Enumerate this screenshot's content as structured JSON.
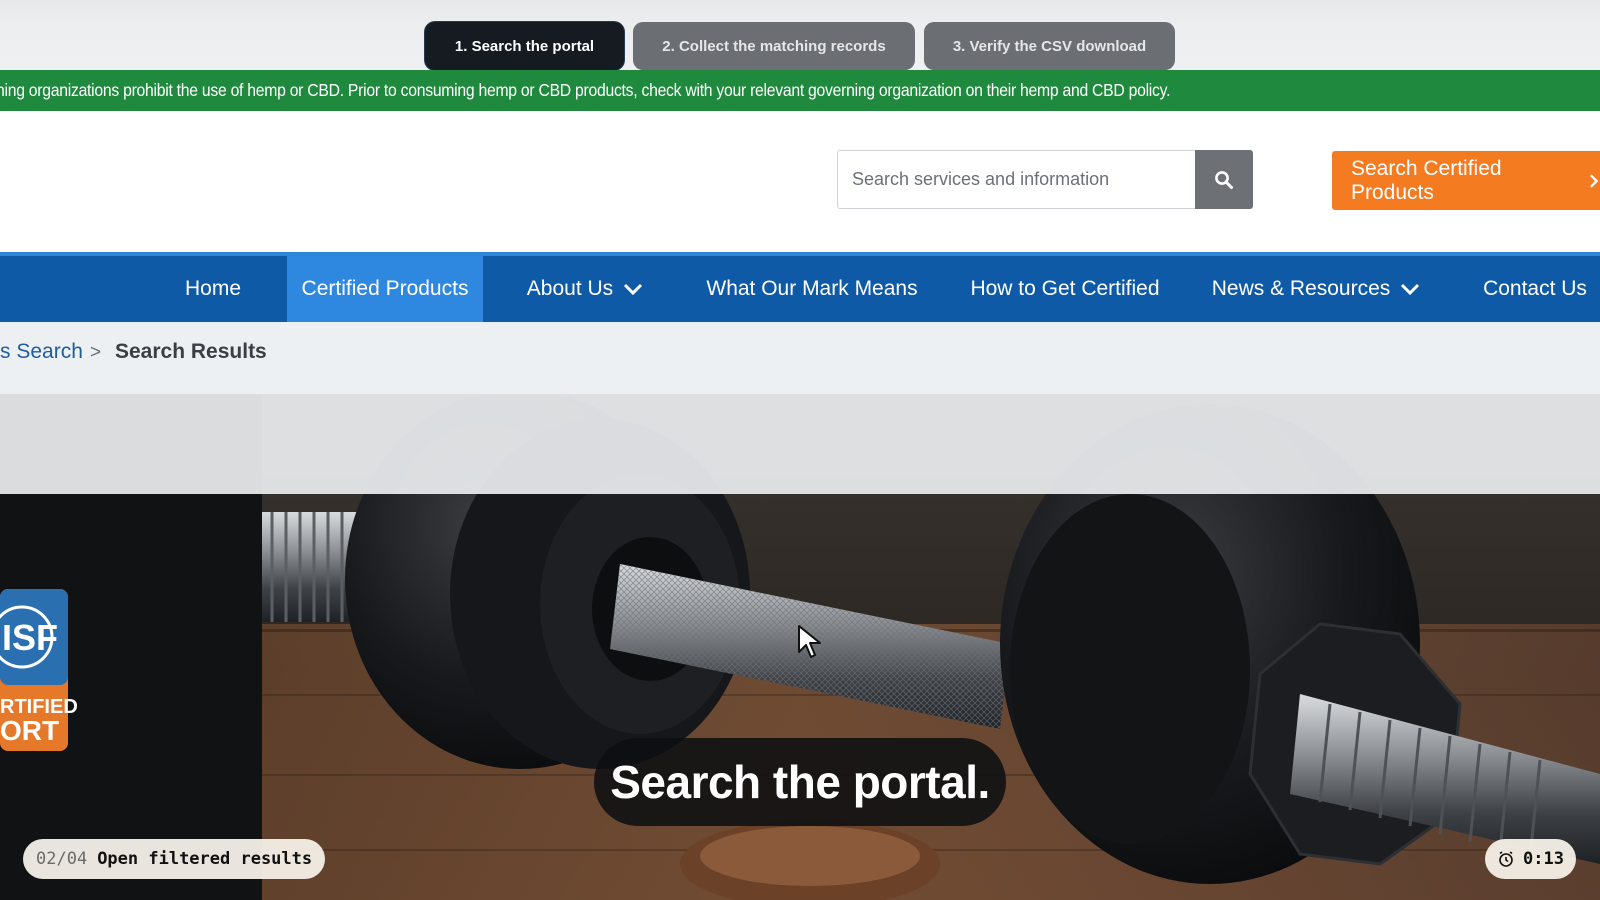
{
  "steps": [
    {
      "label": "1. Search the portal",
      "state": "active"
    },
    {
      "label": "2. Collect the matching records",
      "state": "inactive"
    },
    {
      "label": "3. Verify the CSV download",
      "state": "inactive"
    }
  ],
  "notice": {
    "text": "ning organizations prohibit the use of hemp or CBD. Prior to consuming hemp or CBD products, check with your relevant governing organization on their hemp and CBD policy.",
    "color": "#1f8a3d"
  },
  "header": {
    "search_placeholder": "Search services and information",
    "search_icon": "search-icon",
    "cert_button_label": "Search Certified Products",
    "cert_button_color": "#f47b20"
  },
  "nav": {
    "color": "#0f5aa6",
    "active_color": "#2e88df",
    "items": [
      {
        "label": "Home"
      },
      {
        "label": "Certified Products",
        "active": true
      },
      {
        "label": "About Us",
        "dropdown": true
      },
      {
        "label": "What Our Mark Means"
      },
      {
        "label": "How to Get Certified"
      },
      {
        "label": "News & Resources",
        "dropdown": true
      },
      {
        "label": "Contact Us"
      }
    ]
  },
  "breadcrumb": {
    "link": "s Search",
    "separator": ">",
    "current": "Search Results"
  },
  "hero": {
    "logo_text_top": "ISF",
    "logo_text_mid": "RTIFIED",
    "logo_text_bottom": "ORT"
  },
  "overlay": {
    "caption": "Search the portal.",
    "step_counter": "02/04",
    "step_label": "Open filtered results",
    "timer": "0:13"
  }
}
